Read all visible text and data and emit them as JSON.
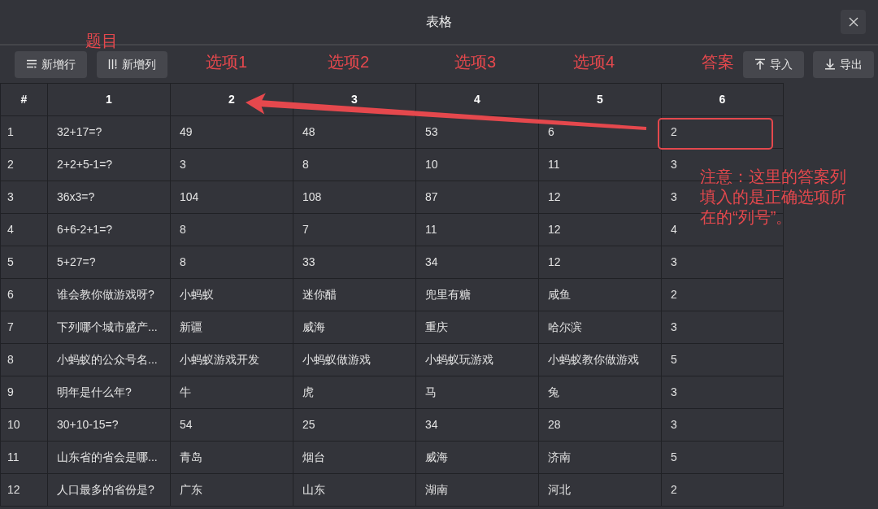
{
  "window": {
    "title": "表格"
  },
  "toolbar": {
    "left_buttons": [
      {
        "label": "新增行",
        "kind": "add-row"
      },
      {
        "label": "新增列",
        "kind": "add-column"
      }
    ],
    "right_buttons": [
      {
        "label": "导入",
        "kind": "import"
      },
      {
        "label": "导出",
        "kind": "export"
      }
    ]
  },
  "table": {
    "columns": [
      "#",
      "1",
      "2",
      "3",
      "4",
      "5",
      "6"
    ],
    "rows": [
      [
        "1",
        "32+17=?",
        "49",
        "48",
        "53",
        "6",
        "2"
      ],
      [
        "2",
        "2+2+5-1=?",
        "3",
        "8",
        "10",
        "11",
        "3"
      ],
      [
        "3",
        "36x3=?",
        "104",
        "108",
        "87",
        "12",
        "3"
      ],
      [
        "4",
        "6+6-2+1=?",
        "8",
        "7",
        "11",
        "12",
        "4"
      ],
      [
        "5",
        "5+27=?",
        "8",
        "33",
        "34",
        "12",
        "3"
      ],
      [
        "6",
        "谁会教你做游戏呀?",
        "小蚂蚁",
        "迷你醋",
        "兜里有糖",
        "咸鱼",
        "2"
      ],
      [
        "7",
        "下列哪个城市盛产...",
        "新疆",
        "威海",
        "重庆",
        "哈尔滨",
        "3"
      ],
      [
        "8",
        "小蚂蚁的公众号名...",
        "小蚂蚁游戏开发",
        "小蚂蚁做游戏",
        "小蚂蚁玩游戏",
        "小蚂蚁教你做游戏",
        "5"
      ],
      [
        "9",
        "明年是什么年?",
        "牛",
        "虎",
        "马",
        "兔",
        "3"
      ],
      [
        "10",
        "30+10-15=?",
        "54",
        "25",
        "34",
        "28",
        "3"
      ],
      [
        "11",
        "山东省的省会是哪...",
        "青岛",
        "烟台",
        "威海",
        "济南",
        "5"
      ],
      [
        "12",
        "人口最多的省份是?",
        "广东",
        "山东",
        "湖南",
        "河北",
        "2"
      ]
    ]
  },
  "annotations": {
    "labels": [
      "题目",
      "选项1",
      "选项2",
      "选项3",
      "选项4",
      "答案"
    ],
    "note": "注意：这里的答案列填入的是正确选项所在的“列号”。"
  }
}
